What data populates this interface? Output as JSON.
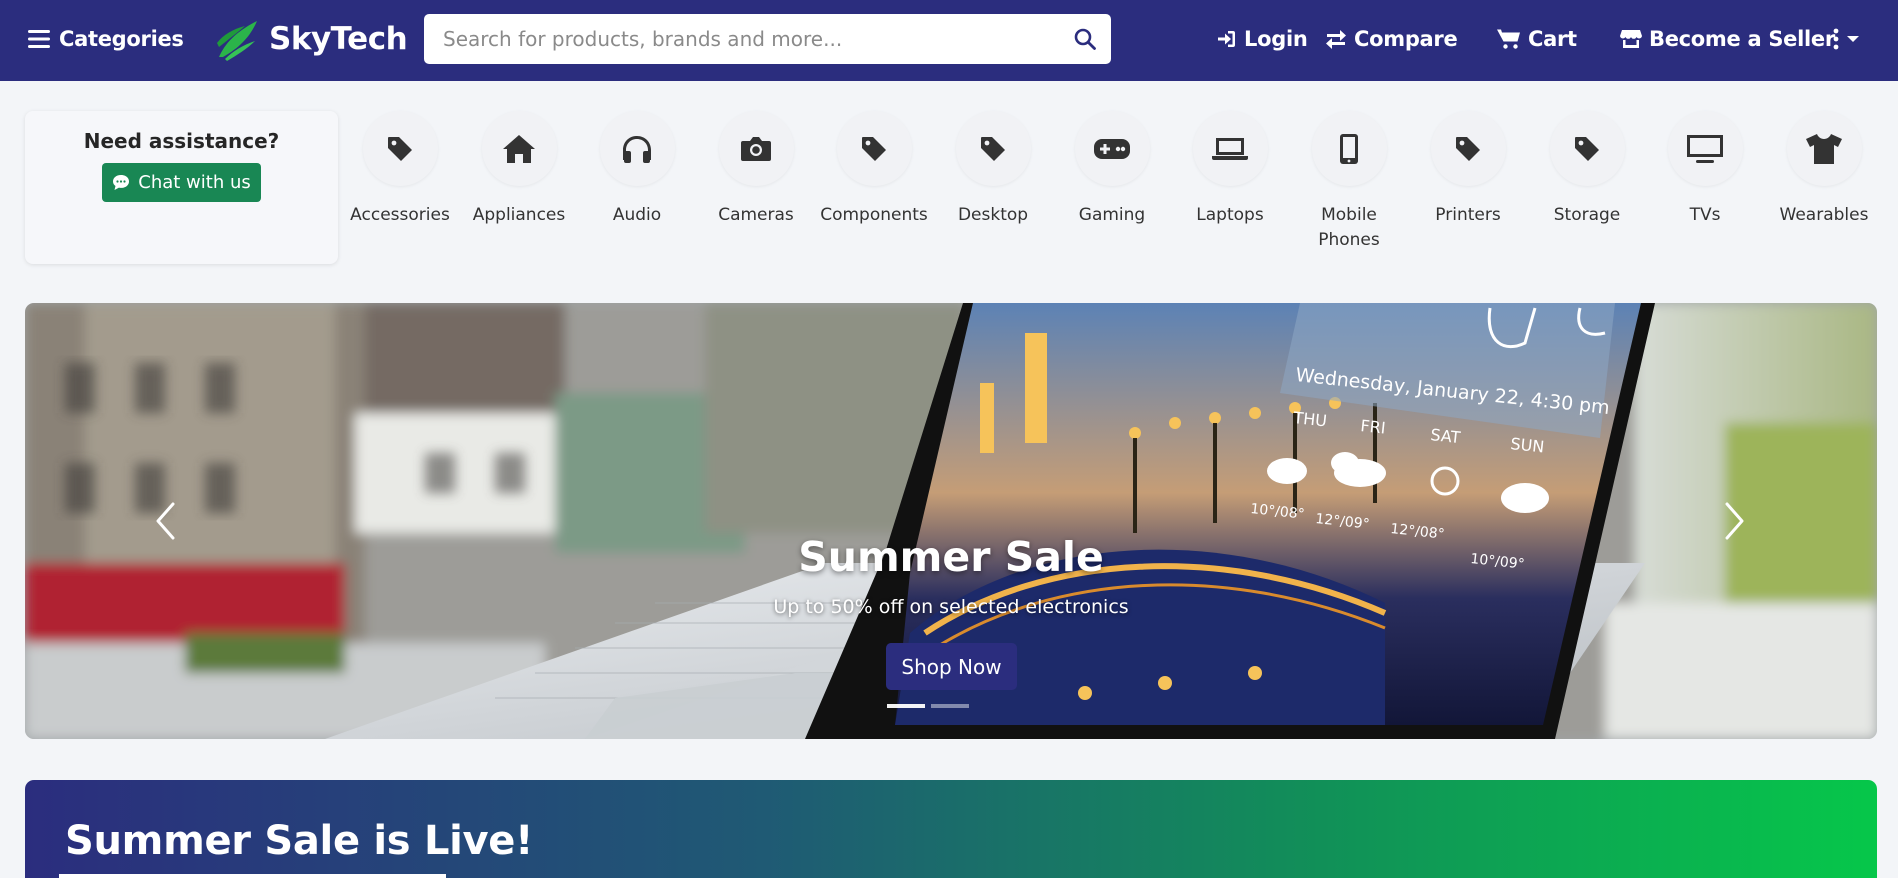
{
  "header": {
    "categories_label": "Categories",
    "brand": "SkyTech",
    "search_placeholder": "Search for products, brands and more...",
    "login_label": "Login",
    "compare_label": "Compare",
    "cart_label": "Cart",
    "seller_label": "Become a Seller"
  },
  "assistance": {
    "title": "Need assistance?",
    "chat_label": "Chat with us"
  },
  "categories": [
    {
      "label": "Accessories",
      "icon": "tag-icon"
    },
    {
      "label": "Appliances",
      "icon": "home-icon"
    },
    {
      "label": "Audio",
      "icon": "headphones-icon"
    },
    {
      "label": "Cameras",
      "icon": "camera-icon"
    },
    {
      "label": "Components",
      "icon": "tag-icon"
    },
    {
      "label": "Desktop",
      "icon": "tag-icon"
    },
    {
      "label": "Gaming",
      "icon": "gamepad-icon"
    },
    {
      "label": "Laptops",
      "icon": "laptop-icon"
    },
    {
      "label": "Mobile Phones",
      "icon": "mobile-icon"
    },
    {
      "label": "Printers",
      "icon": "tag-icon"
    },
    {
      "label": "Storage",
      "icon": "tag-icon"
    },
    {
      "label": "TVs",
      "icon": "tv-icon"
    },
    {
      "label": "Wearables",
      "icon": "tshirt-icon"
    }
  ],
  "hero": {
    "title": "Summer Sale",
    "subtitle": "Up to 50% off on selected electronics",
    "button_label": "Shop Now",
    "screen": {
      "datetime": "Wednesday, January 22, 4:30 pm",
      "days": [
        "THU",
        "FRI",
        "SAT",
        "SUN"
      ],
      "temps": [
        "10°/08°",
        "12°/09°",
        "12°/08°",
        "10°/09°"
      ]
    }
  },
  "promo": {
    "title": "Summer Sale is Live!"
  },
  "colors": {
    "header_bg": "#2b2d7e",
    "brand_green": "#2bb44a",
    "chat_green": "#198754",
    "shop_button": "#2b2d7e"
  }
}
